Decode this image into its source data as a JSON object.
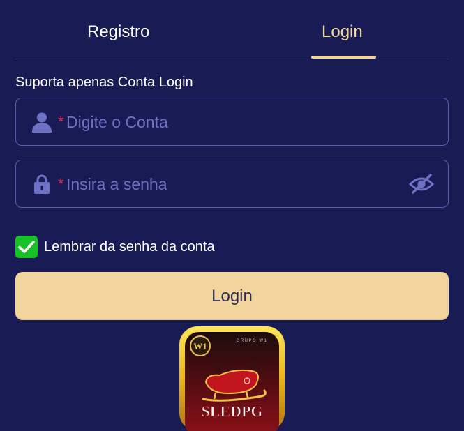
{
  "tabs": {
    "registro": "Registro",
    "login": "Login"
  },
  "support_text": "Suporta apenas Conta Login",
  "account_field": {
    "required_mark": "*",
    "placeholder": "Digite o Conta",
    "icon": "user-icon"
  },
  "password_field": {
    "required_mark": "*",
    "placeholder": "Insira a senha",
    "icon": "lock-icon",
    "toggle_icon": "eye-off-icon"
  },
  "remember": {
    "label": "Lembrar da senha da conta",
    "checked": true
  },
  "login_button": "Login",
  "logo": {
    "group_text": "GRUPO W1",
    "badge_text": "W1",
    "name": "SLEDPG"
  },
  "colors": {
    "background": "#191b54",
    "accent": "#f1d59c",
    "field_border": "#5c60b2",
    "placeholder": "#6d72c4",
    "required": "#e8355a",
    "checkbox": "#17c126"
  }
}
